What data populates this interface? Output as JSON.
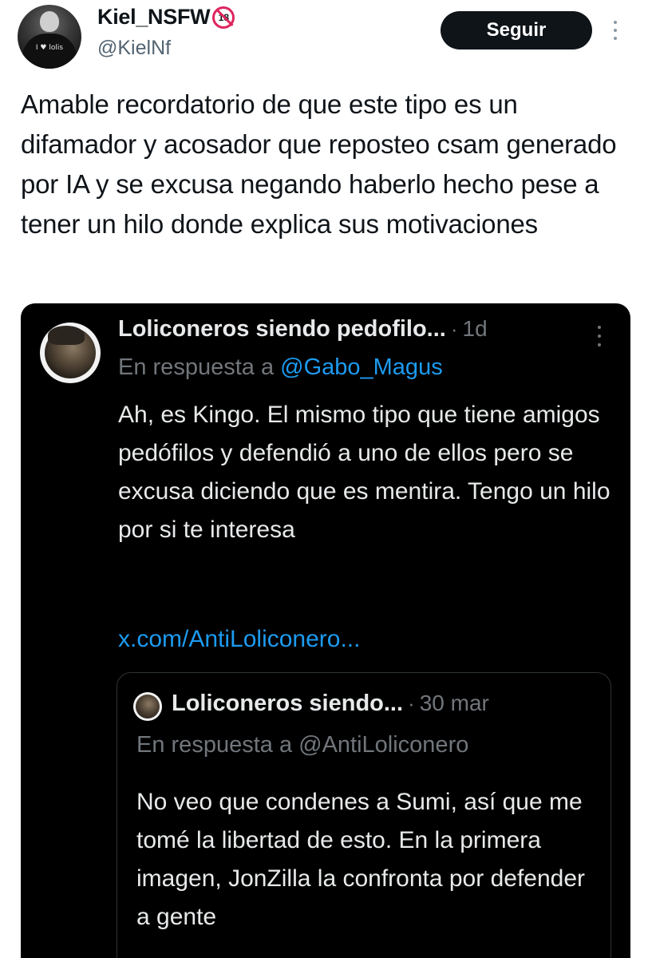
{
  "author": {
    "display_name": "Kiel_NSFW",
    "badge": "18",
    "handle": "@KielNf",
    "avatar_text": "I ♥ lolis"
  },
  "actions": {
    "follow_label": "Seguir"
  },
  "tweet": {
    "text": "Amable recordatorio de que este tipo es un difamador y acosador que reposteo csam generado por IA y se excusa negando haberlo hecho pese a tener un hilo donde explica sus motivaciones"
  },
  "embedded_tweet": {
    "name": "Loliconeros siendo pedofilo...",
    "separator": "·",
    "time": "1d",
    "reply_prefix": "En respuesta a ",
    "reply_mention": "@Gabo_Magus",
    "text": "Ah, es Kingo. El mismo tipo que tiene amigos pedófilos y defendió a uno de ellos pero se excusa diciendo que es mentira. Tengo un hilo por si te interesa",
    "link": "x.com/AntiLoliconero...",
    "quoted": {
      "name": "Loliconeros siendo...",
      "separator": "·",
      "time": "30 mar",
      "reply_text": "En respuesta a @AntiLoliconero",
      "text": "No veo que condenes a Sumi, así que me tomé la libertad de esto. En la primera imagen, JonZilla la confronta por defender a gente"
    }
  },
  "colors": {
    "text_primary": "#0f1419",
    "text_secondary": "#536471",
    "dark_bg": "#000000",
    "dark_text": "#e7e9ea",
    "dark_muted": "#71767b",
    "link_blue": "#1d9bf0",
    "nsfw_red": "#e0245e"
  },
  "icons": [
    "more-vertical-icon",
    "nsfw-18-icon"
  ]
}
